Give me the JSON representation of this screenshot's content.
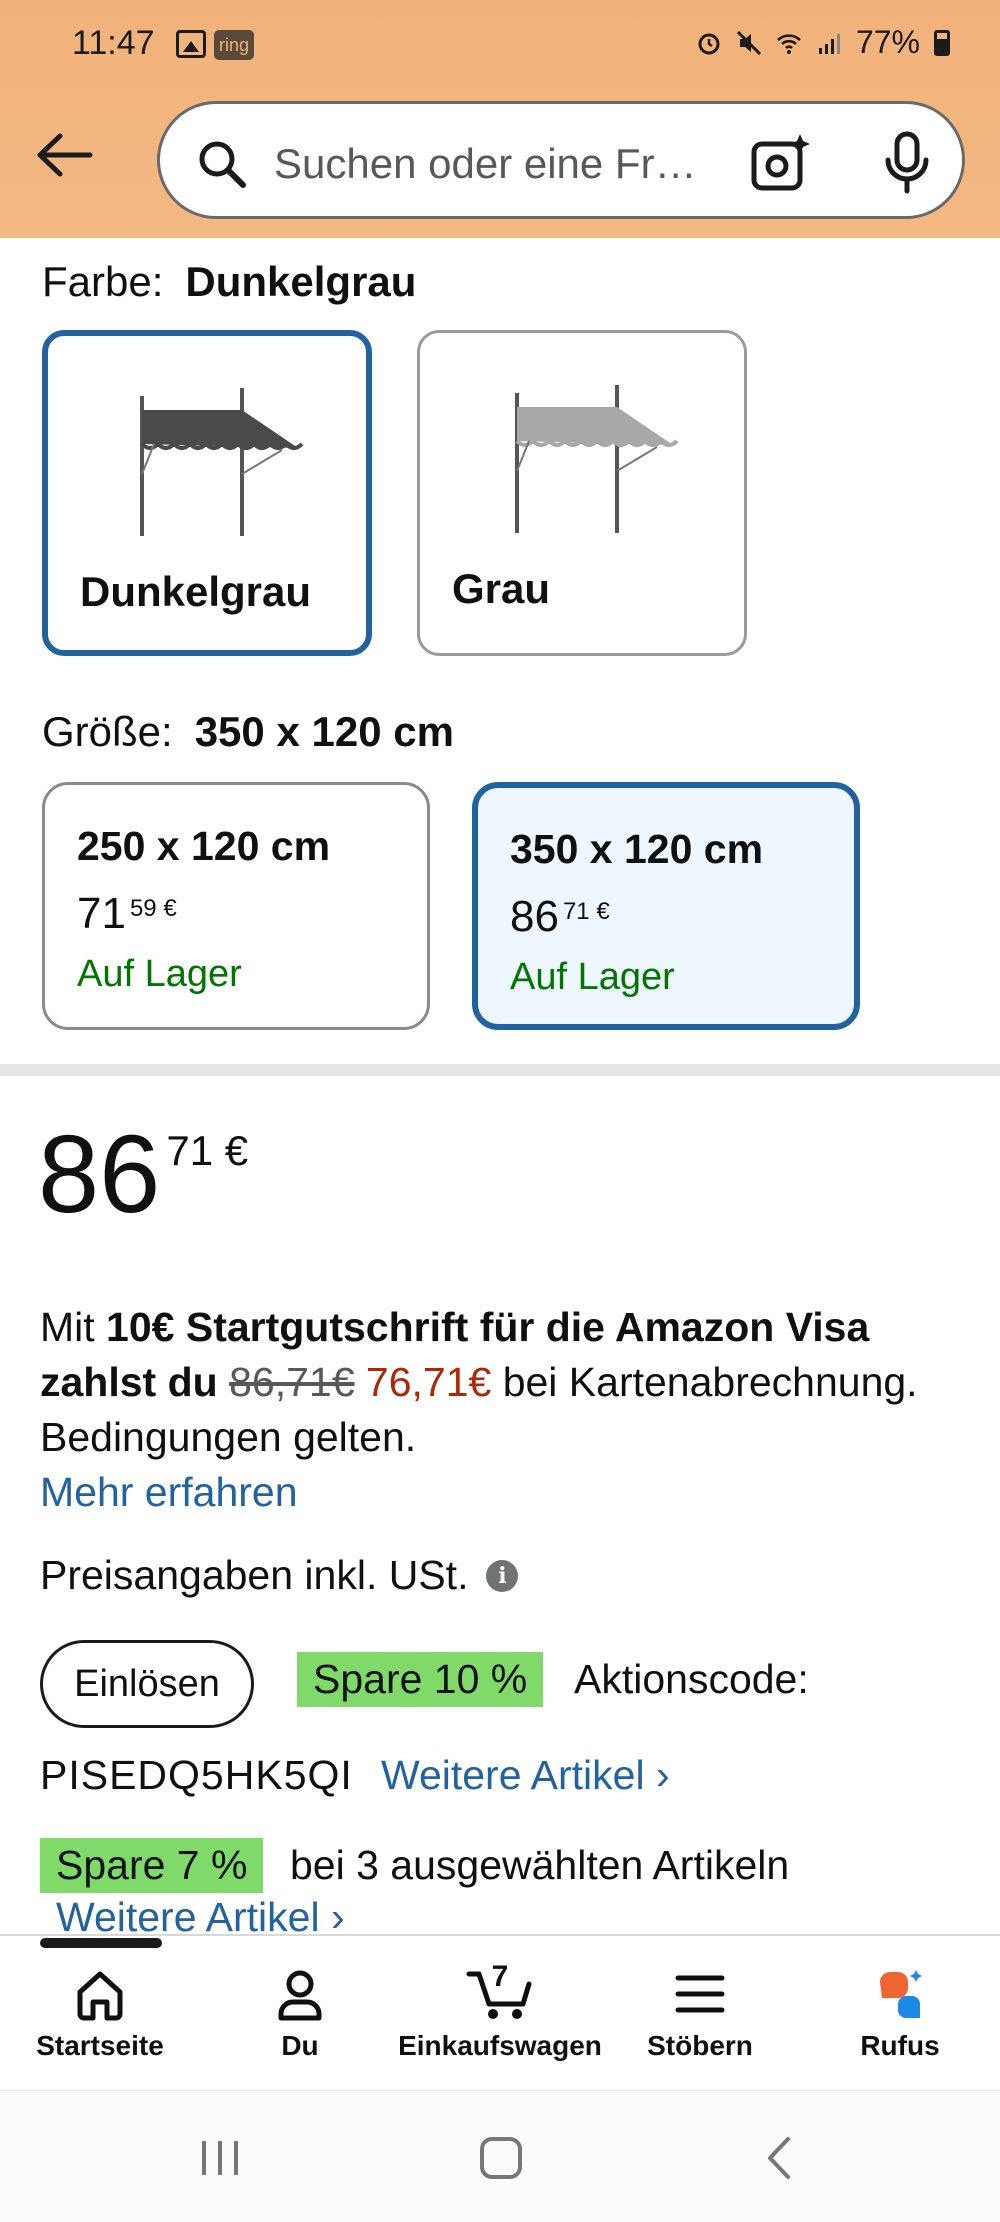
{
  "status_bar": {
    "time": "11:47",
    "ring_label": "ring",
    "battery": "77%"
  },
  "search": {
    "placeholder": "Suchen oder eine Fr…"
  },
  "color_section": {
    "label": "Farbe:",
    "selected": "Dunkelgrau",
    "options": [
      {
        "name": "Dunkelgrau",
        "swatch_color": "#4a4a4a",
        "selected": true
      },
      {
        "name": "Grau",
        "swatch_color": "#a8a8a8",
        "selected": false
      }
    ]
  },
  "size_section": {
    "label": "Größe:",
    "selected": "350 x 120 cm",
    "options": [
      {
        "size": "250 x 120 cm",
        "price_whole": "71",
        "price_fraction": "59",
        "currency": "€",
        "stock": "Auf Lager",
        "selected": false
      },
      {
        "size": "350 x 120 cm",
        "price_whole": "86",
        "price_fraction": "71",
        "currency": "€",
        "stock": "Auf Lager",
        "selected": true
      }
    ]
  },
  "price": {
    "whole": "86",
    "fraction": "71",
    "currency": "€"
  },
  "visa_offer": {
    "prefix": "Mit ",
    "bold": "10€ Startgutschrift für die Amazon Visa zahlst du",
    "old_price": "86,71€",
    "new_price": "76,71€",
    "suffix": " bei Kartenabrechnung. Bedingungen gelten.",
    "link": "Mehr erfahren"
  },
  "vat_note": "Preisangaben inkl. USt.",
  "coupons": {
    "redeem_button": "Einlösen",
    "badge_10": "Spare 10 %",
    "code_label": "Aktionscode:",
    "code": "PISEDQ5HK5QI",
    "more_link_1": "Weitere Artikel ›",
    "badge_7": "Spare 7 %",
    "selected_items_text": "bei 3 ausgewählten Artikeln",
    "more_link_2": "Weitere Artikel ›"
  },
  "bottom_nav": {
    "items": [
      {
        "label": "Startseite",
        "icon": "home-icon"
      },
      {
        "label": "Du",
        "icon": "person-icon"
      },
      {
        "label": "Einkaufswagen",
        "icon": "cart-icon",
        "count": "7"
      },
      {
        "label": "Stöbern",
        "icon": "menu-icon"
      },
      {
        "label": "Rufus",
        "icon": "rufus-icon"
      }
    ]
  },
  "colors": {
    "header_bg": "#f1b27a",
    "link": "#2162a1",
    "in_stock": "#007600",
    "deal_price": "#b12704",
    "badge": "#7fda69",
    "selected_border": "#2162a1"
  }
}
